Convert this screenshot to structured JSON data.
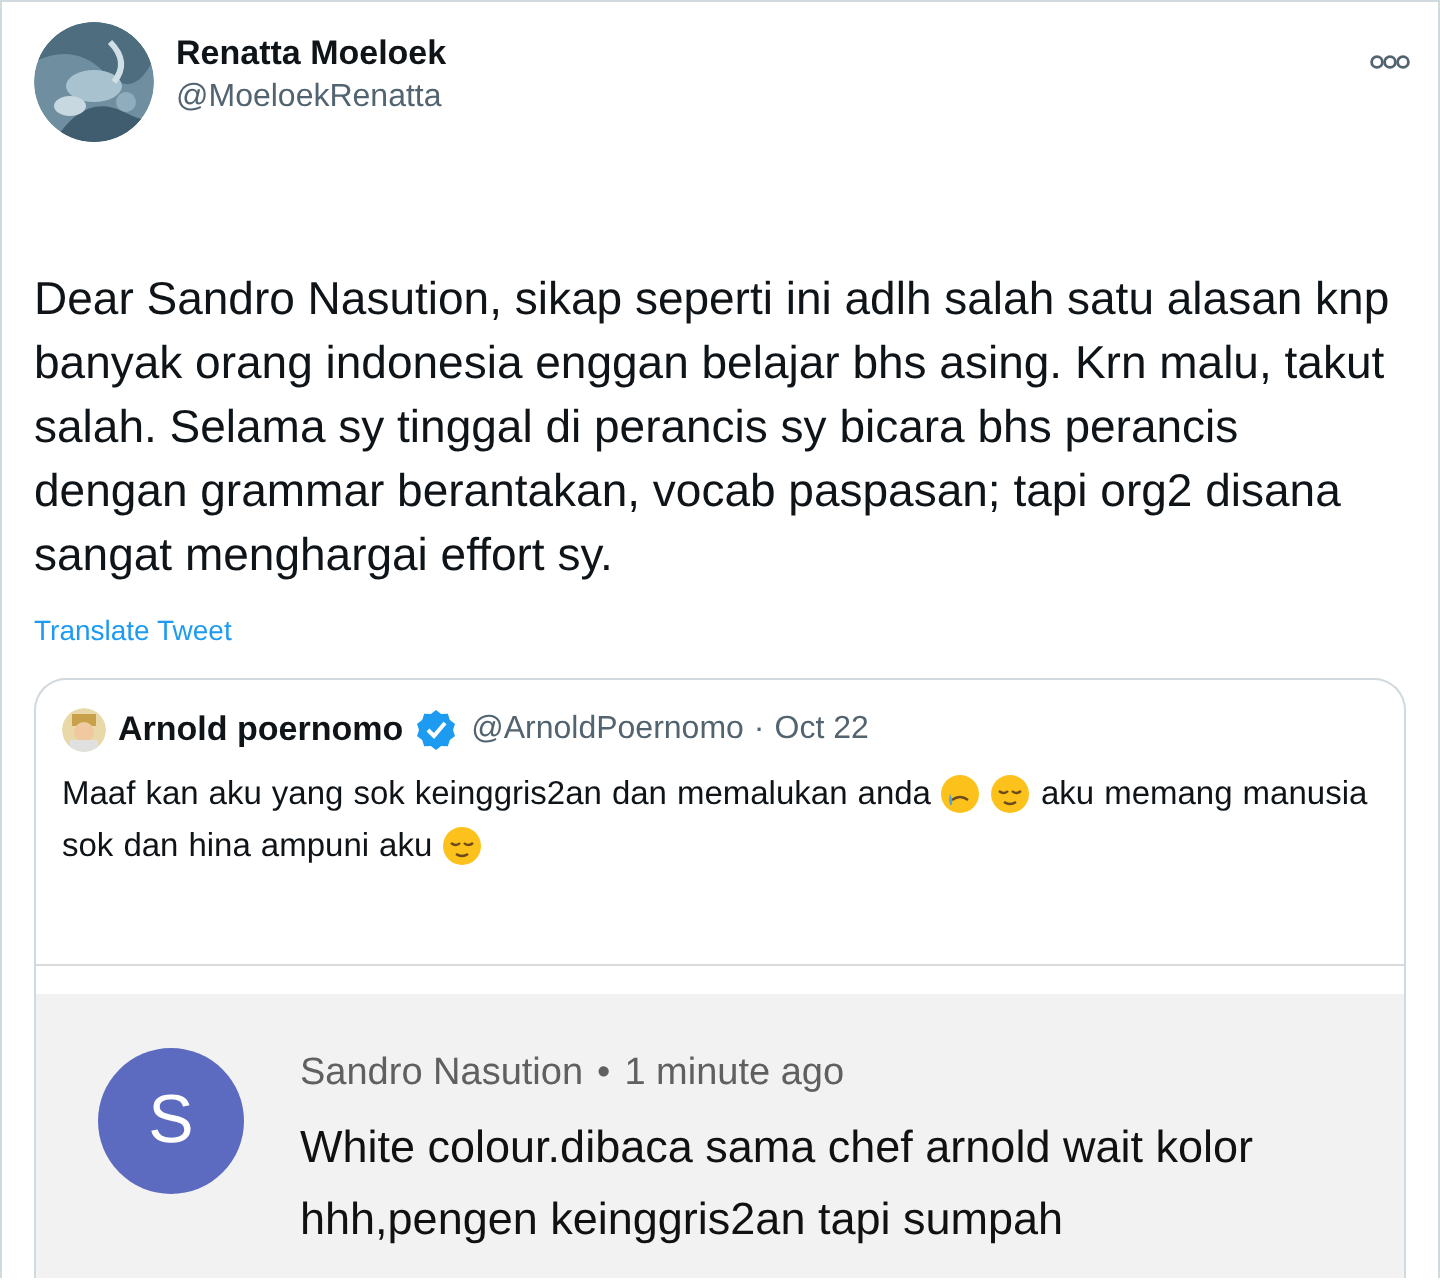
{
  "tweet": {
    "author": {
      "name": "Renatta Moeloek",
      "handle": "@MoeloekRenatta"
    },
    "text": "Dear Sandro Nasution, sikap seperti ini adlh salah satu alasan knp banyak orang indonesia enggan belajar bhs asing. Krn malu, takut salah. Selama sy tinggal di perancis sy bicara bhs perancis dengan grammar berantakan, vocab paspasan; tapi org2 disana sangat menghargai effort sy.",
    "translate_link": "Translate Tweet",
    "quoted_tweet": {
      "author": {
        "name": "Arnold poernomo",
        "verified": true,
        "handle": "@ArnoldPoernomo",
        "separator": "·",
        "date": "Oct 22"
      },
      "text_parts": [
        {
          "kind": "text",
          "text": "Maaf kan aku yang sok keinggris2an dan memalukan anda"
        },
        {
          "kind": "tear"
        },
        {
          "kind": "calm"
        },
        {
          "kind": "text",
          "text": "aku memang manusia sok dan hina ampuni aku"
        },
        {
          "kind": "calm"
        }
      ],
      "image": {
        "comment": {
          "avatar_letter": "S",
          "author": "Sandro Nasution",
          "separator": "•",
          "time": "1 minute ago",
          "text": "White colour.dibaca sama chef arnold wait kolor hhh,pengen keinggris2an tapi sumpah"
        }
      }
    }
  }
}
